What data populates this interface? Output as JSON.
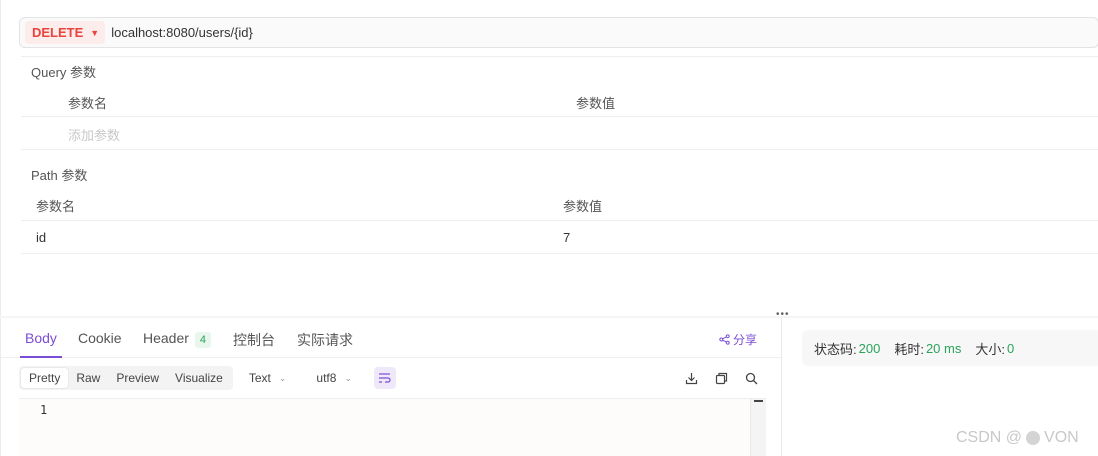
{
  "request": {
    "method": "DELETE",
    "url": "localhost:8080/users/{id}"
  },
  "query_params": {
    "title": "Query 参数",
    "col_name": "参数名",
    "col_value": "参数值",
    "add_placeholder": "添加参数"
  },
  "path_params": {
    "title": "Path 参数",
    "col_name": "参数名",
    "col_value": "参数值",
    "rows": [
      {
        "name": "id",
        "value": "7"
      }
    ]
  },
  "response_tabs": {
    "tabs": [
      {
        "label": "Body"
      },
      {
        "label": "Cookie"
      },
      {
        "label": "Header",
        "badge": "4"
      },
      {
        "label": "控制台"
      },
      {
        "label": "实际请求"
      }
    ],
    "active": "Body",
    "share_label": "分享"
  },
  "format_toolbar": {
    "modes": [
      "Pretty",
      "Raw",
      "Preview",
      "Visualize"
    ],
    "active_mode": "Pretty",
    "content_type": "Text",
    "encoding": "utf8"
  },
  "editor": {
    "line_numbers": [
      "1"
    ]
  },
  "status": {
    "code_label": "状态码:",
    "code_value": "200",
    "time_label": "耗时:",
    "time_value": "20 ms",
    "size_label": "大小:",
    "size_value": "0"
  },
  "watermark": {
    "prefix": "CSDN @",
    "suffix": "VON"
  },
  "colors": {
    "accent": "#7c4dd6",
    "method_delete": "#e8433c",
    "success": "#2aa35a"
  },
  "icons": {
    "method_dropdown": "chevron-down-icon",
    "share": "share-icon",
    "wrap": "word-wrap-icon",
    "download": "download-icon",
    "copy": "copy-icon",
    "search": "search-icon"
  }
}
